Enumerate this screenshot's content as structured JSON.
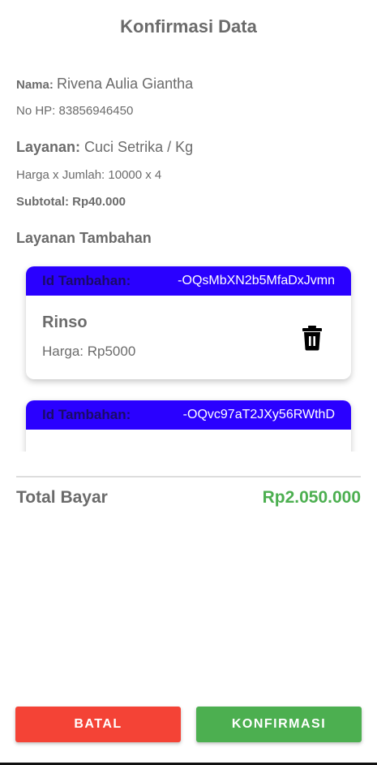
{
  "header": {
    "title": "Konfirmasi Data"
  },
  "customer": {
    "name_label": "Nama:",
    "name_value": "Rivena Aulia Giantha",
    "phone_text": "No HP: 83856946450"
  },
  "service": {
    "label": "Layanan:",
    "value": "Cuci Setrika / Kg",
    "price_qty_text": "Harga x Jumlah: 10000 x 4",
    "subtotal_text": "Subtotal: Rp40.000"
  },
  "extras": {
    "heading": "Layanan Tambahan",
    "items": [
      {
        "id_label": "Id Tambahan:",
        "id_value": "-OQsMbXN2b5MfaDxJvmn",
        "name": "Rinso",
        "price_text": "Harga: Rp5000"
      },
      {
        "id_label": "Id Tambahan:",
        "id_value": "-OQvc97aT2JXy56RWthD",
        "name": "",
        "price_text": ""
      }
    ]
  },
  "total": {
    "label": "Total Bayar",
    "value": "Rp2.050.000"
  },
  "actions": {
    "cancel_label": "BATAL",
    "confirm_label": "KONFIRMASI"
  },
  "colors": {
    "card_header": "#2a00ff",
    "cancel": "#f44336",
    "confirm": "#4caf50",
    "total_value": "#4caf50"
  },
  "icons": {
    "delete": "trash-icon"
  }
}
